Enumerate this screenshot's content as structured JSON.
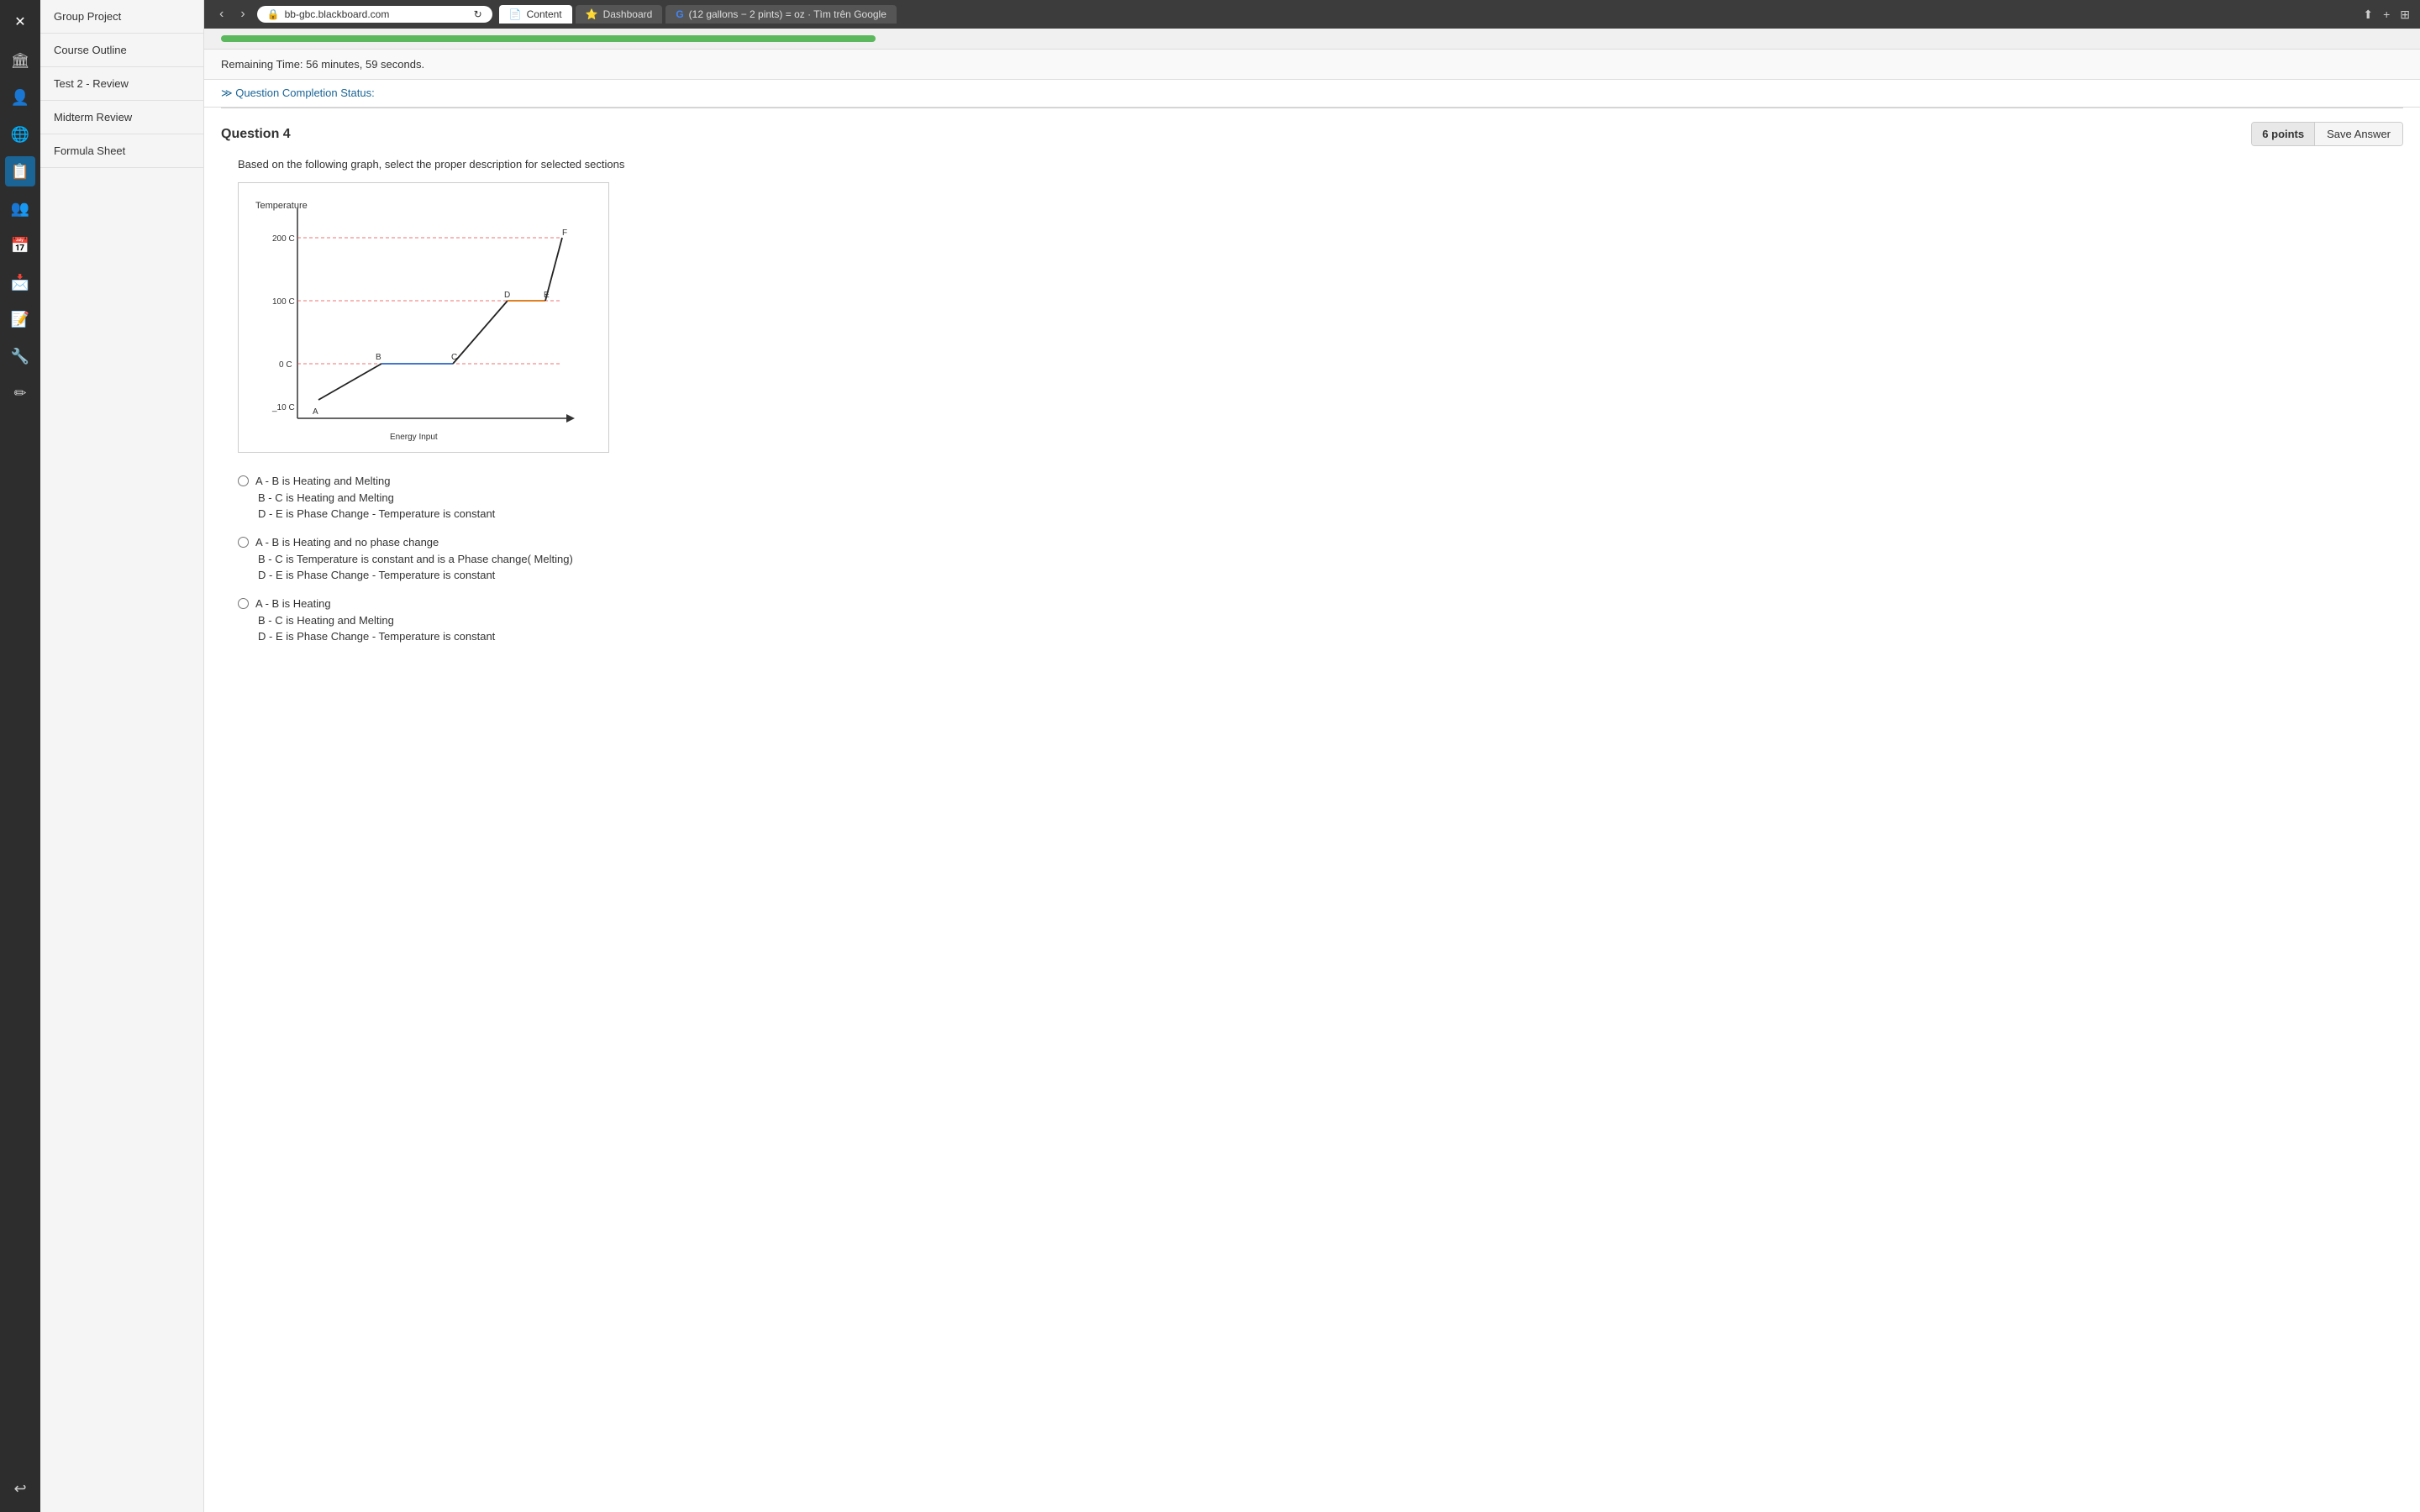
{
  "browser": {
    "tabs": [
      {
        "label": "Content",
        "icon": "📄",
        "active": true
      },
      {
        "label": "Dashboard",
        "icon": "⭐",
        "active": false
      },
      {
        "label": "(12 gallons − 2 pints) = oz · Tìm trên Google",
        "icon": "G",
        "active": false
      }
    ],
    "url": "bb-gbc.blackboard.com",
    "shield_icon": "🛡",
    "reload_icon": "↻"
  },
  "nav_icons": [
    {
      "name": "home",
      "symbol": "⊞",
      "active": false
    },
    {
      "name": "back",
      "symbol": "‹",
      "active": false
    },
    {
      "name": "forward",
      "symbol": "›",
      "active": false
    },
    {
      "name": "shield",
      "symbol": "🛡",
      "active": false
    },
    {
      "name": "share",
      "symbol": "⬆",
      "active": false
    },
    {
      "name": "new-tab",
      "symbol": "+",
      "active": false
    },
    {
      "name": "grid",
      "symbol": "⊞",
      "active": false
    }
  ],
  "sidebar": {
    "items": [
      {
        "label": "Group Project"
      },
      {
        "label": "Course Outline"
      },
      {
        "label": "Test 2 - Review"
      },
      {
        "label": "Midterm Review"
      },
      {
        "label": "Formula Sheet"
      }
    ]
  },
  "left_icons": [
    {
      "symbol": "✕",
      "type": "close"
    },
    {
      "symbol": "🏛",
      "type": "home"
    },
    {
      "symbol": "👤",
      "type": "profile"
    },
    {
      "symbol": "🌐",
      "type": "globe"
    },
    {
      "symbol": "📋",
      "type": "content",
      "active": true
    },
    {
      "symbol": "👥",
      "type": "groups"
    },
    {
      "symbol": "📅",
      "type": "calendar"
    },
    {
      "symbol": "📩",
      "type": "messages"
    },
    {
      "symbol": "📝",
      "type": "grades"
    },
    {
      "symbol": "🔧",
      "type": "tools"
    },
    {
      "symbol": "✏",
      "type": "edit"
    },
    {
      "symbol": "↩",
      "type": "back"
    }
  ],
  "timer": {
    "label": "Remaining Time:",
    "value": "56 minutes, 59 seconds."
  },
  "completion": {
    "label": "Question Completion Status:"
  },
  "question": {
    "number": "Question 4",
    "points": "6 points",
    "save_label": "Save Answer",
    "text": "Based on the following graph, select the proper description for selected sections"
  },
  "graph": {
    "title": "Temperature",
    "x_label": "Energy Input",
    "y_labels": [
      "200 C",
      "100 C",
      "0 C",
      "-10 C"
    ],
    "point_labels": [
      "A",
      "B",
      "C",
      "D",
      "E",
      "F"
    ]
  },
  "answer_groups": [
    {
      "id": "group1",
      "radio": true,
      "lines": [
        "A - B   is Heating and Melting",
        "B - C is  Heating and Melting",
        "D - E is  Phase Change  - Temperature is constant"
      ]
    },
    {
      "id": "group2",
      "radio": true,
      "lines": [
        "A - B   is Heating and no phase change",
        "B - C is  Temperature is constant and is a Phase change( Melting)",
        "D - E is  Phase Change  - Temperature is constant"
      ]
    },
    {
      "id": "group3",
      "radio": true,
      "lines": [
        "A - B   is Heating",
        "B - C is  Heating and Melting",
        "D - E is  Phase Change  - Temperature is constant"
      ]
    }
  ]
}
